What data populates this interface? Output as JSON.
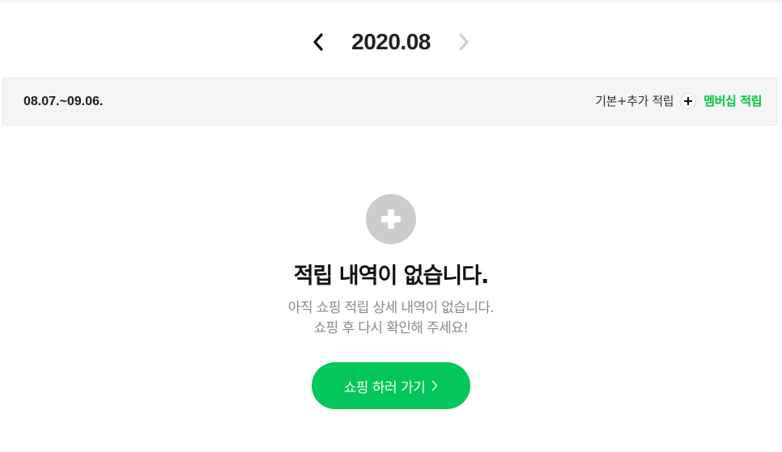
{
  "header": {
    "month": "2020.08",
    "prev_icon": "chevron-left-icon",
    "next_icon": "chevron-right-icon"
  },
  "period": {
    "range": "08.07.~09.06.",
    "base_label": "기본+추가 적립",
    "member_label": "멤버십 적립",
    "plus_icon": "plus-icon"
  },
  "empty_state": {
    "icon": "plus-circle-icon",
    "title": "적립 내역이 없습니다.",
    "desc_line1": "아직 쇼핑 적립 상세 내역이 없습니다.",
    "desc_line2": "쇼핑 후 다시 확인해 주세요!",
    "button_label": "쇼핑 하러 가기"
  },
  "colors": {
    "accent_green": "#03c75a",
    "member_green": "#00c73c",
    "disabled_grey": "#cccccc"
  }
}
